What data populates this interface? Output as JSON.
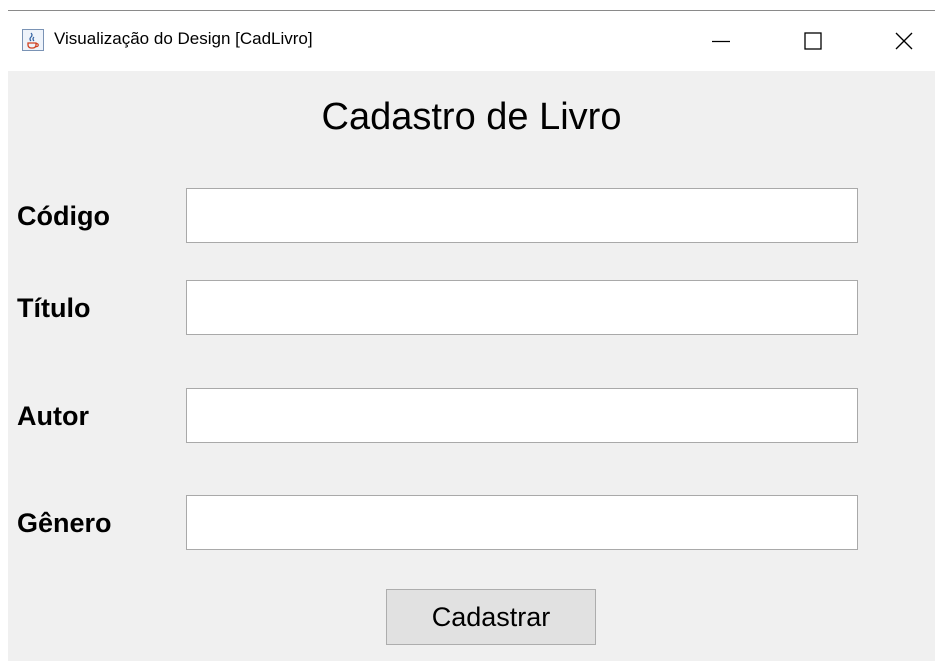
{
  "window": {
    "title": "Visualização do Design [CadLivro]",
    "app_icon": "java-cup-icon",
    "controls": {
      "minimize_icon": "minimize-icon",
      "maximize_icon": "maximize-icon",
      "close_icon": "close-icon"
    }
  },
  "form": {
    "title": "Cadastro de Livro",
    "fields": [
      {
        "label": "Código",
        "value": "",
        "placeholder": ""
      },
      {
        "label": "Título",
        "value": "",
        "placeholder": ""
      },
      {
        "label": "Autor",
        "value": "",
        "placeholder": ""
      },
      {
        "label": "Gênero",
        "value": "",
        "placeholder": ""
      }
    ],
    "submit_label": "Cadastrar"
  },
  "colors": {
    "window_background": "#f0f0f0",
    "titlebar_background": "#ffffff",
    "input_border": "#a9a9a9",
    "button_background": "#e1e1e1"
  }
}
